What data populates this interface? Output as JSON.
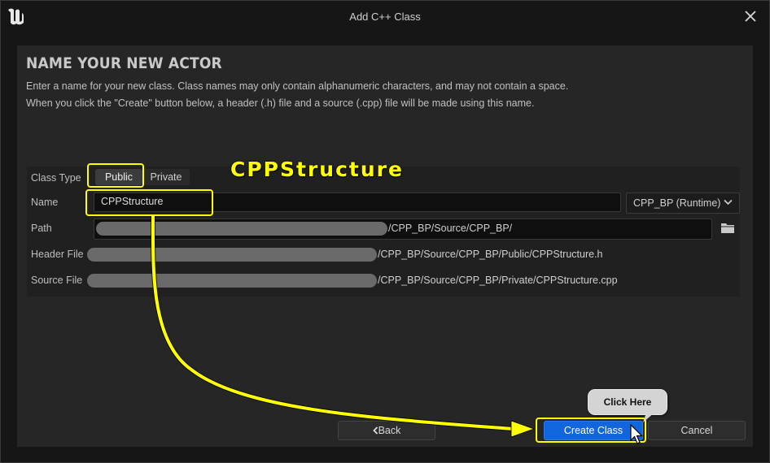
{
  "window": {
    "title": "Add C++ Class"
  },
  "header": {
    "heading": "NAME YOUR NEW ACTOR",
    "description_line1": "Enter a name for your new class. Class names may only contain alphanumeric characters, and may not contain a space.",
    "description_line2": "When you click the \"Create\" button below, a header (.h) file and a source (.cpp) file will be made using this name."
  },
  "form": {
    "class_type_label": "Class Type",
    "class_type_options": [
      "Public",
      "Private"
    ],
    "class_type_selected": "Public",
    "name_label": "Name",
    "name_value": "CPPStructure",
    "module_value": "CPP_BP (Runtime)",
    "path_label": "Path",
    "path_value": "/CPP_BP/Source/CPP_BP/",
    "header_file_label": "Header File",
    "header_file_value": "/CPP_BP/Source/CPP_BP/Public/CPPStructure.h",
    "source_file_label": "Source File",
    "source_file_value": "/CPP_BP/Source/CPP_BP/Private/CPPStructure.cpp"
  },
  "buttons": {
    "back": "Back",
    "create": "Create Class",
    "cancel": "Cancel"
  },
  "annotations": {
    "name_callout": "CPPStructure",
    "click_callout": "Click Here",
    "color": "#ffff00"
  },
  "icons": [
    "unreal-logo-icon",
    "close-icon",
    "chevron-down-icon",
    "folder-icon",
    "chevron-left-icon",
    "mouse-cursor-icon"
  ],
  "colors": {
    "accent": "#1166dd",
    "annotation": "#ffff00"
  }
}
